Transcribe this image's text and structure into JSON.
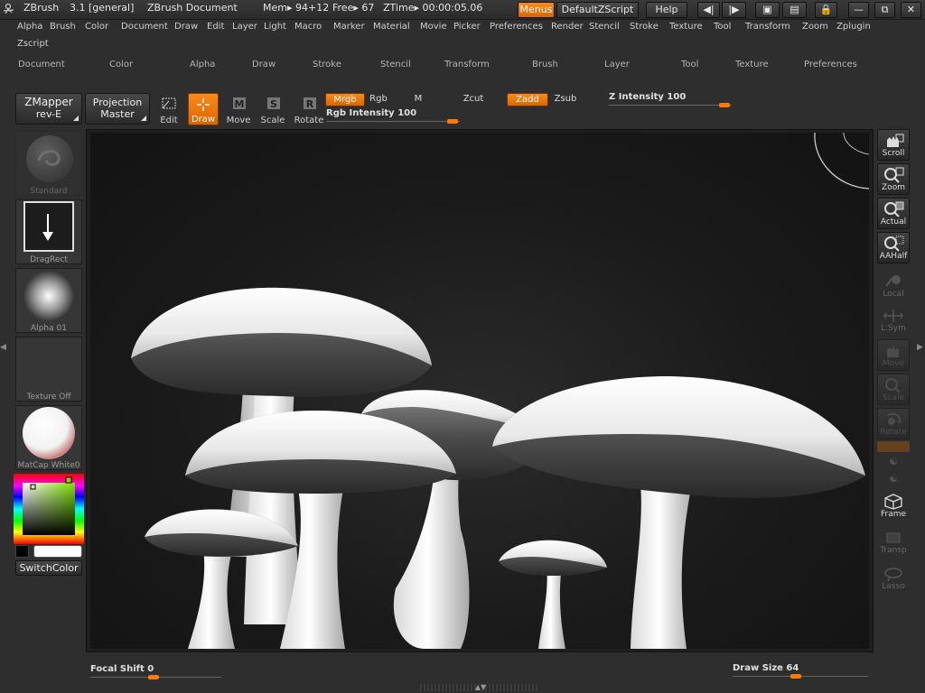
{
  "titlebar": {
    "app": "ZBrush",
    "version": "3.1 [general]",
    "document": "ZBrush Document",
    "mem": "Mem▸ 94+12",
    "free": "Free▸ 67",
    "ztime": "ZTime▸ 00:00:05.06",
    "menus_btn": "Menus",
    "script_btn": "DefaultZScript",
    "help_btn": "Help"
  },
  "menu": {
    "row1": [
      "Alpha",
      "Brush",
      "Color",
      "Document",
      "Draw",
      "Edit",
      "Layer",
      "Light",
      "Macro",
      "Marker",
      "Material",
      "Movie",
      "Picker",
      "Preferences",
      "Render",
      "Stencil",
      "Stroke",
      "Texture",
      "Tool",
      "Transform",
      "Zoom",
      "Zplugin"
    ],
    "row2": [
      "Zscript"
    ]
  },
  "palette_tray": [
    "Document",
    "Color",
    "Alpha",
    "Draw",
    "Stroke",
    "Stencil",
    "Transform",
    "Brush",
    "Layer",
    "Tool",
    "Texture",
    "Preferences"
  ],
  "toolbar": {
    "zmapper_line1": "ZMapper",
    "zmapper_line2": "rev-E",
    "projection_line1": "Projection",
    "projection_line2": "Master",
    "edit": "Edit",
    "draw": "Draw",
    "move": "Move",
    "scale": "Scale",
    "rotate": "Rotate",
    "mrgb": "Mrgb",
    "rgb": "Rgb",
    "m": "M",
    "zcut": "Zcut",
    "zadd": "Zadd",
    "zsub": "Zsub",
    "rgb_intensity_label": "Rgb Intensity",
    "rgb_intensity_value": "100",
    "z_intensity_label": "Z Intensity",
    "z_intensity_value": "100"
  },
  "left_shelf": {
    "brush": "Standard",
    "stroke": "DragRect",
    "alpha": "Alpha 01",
    "texture": "Texture Off",
    "material": "MatCap White0",
    "switch_color": "SwitchColor"
  },
  "right_shelf": {
    "scroll": "Scroll",
    "zoom": "Zoom",
    "actual": "Actual",
    "aahalf": "AAHalf",
    "local": "Local",
    "lsym": "L.Sym",
    "move": "Move",
    "scale": "Scale",
    "rotate": "Rotate",
    "frame": "Frame",
    "transp": "Transp",
    "lasso": "Lasso"
  },
  "bottom": {
    "focal_shift_label": "Focal Shift",
    "focal_shift_value": "0",
    "draw_size_label": "Draw Size",
    "draw_size_value": "64"
  },
  "colors": {
    "accent": "#ff7a00",
    "background": "#2e2e2e"
  }
}
